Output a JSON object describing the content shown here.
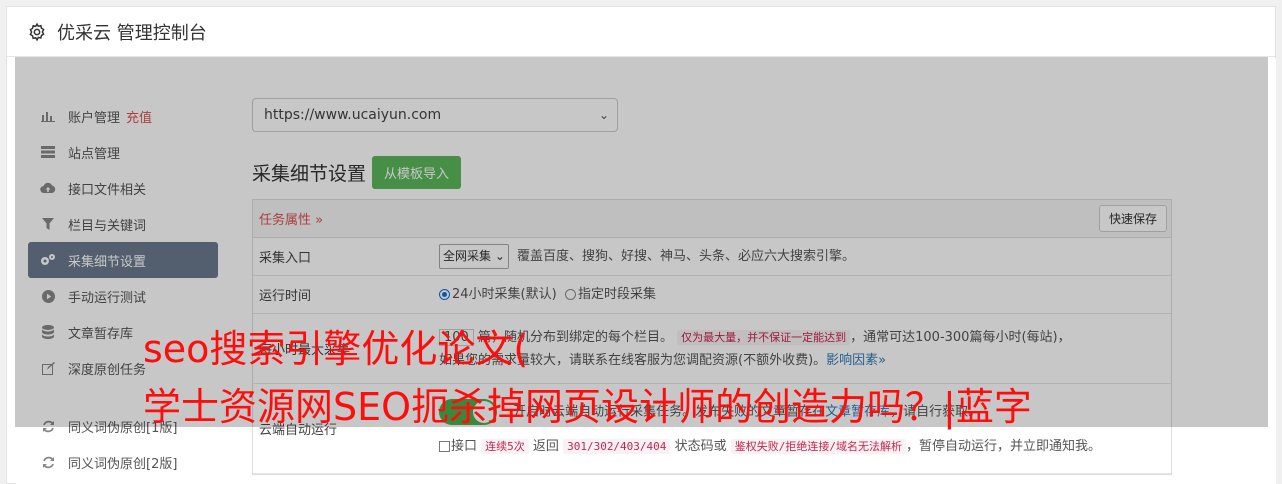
{
  "header": {
    "title": "优采云 管理控制台",
    "icon": "gear-icon"
  },
  "sidebar": {
    "items": [
      {
        "label": "账户管理",
        "badge": "充值",
        "icon": "bar-chart-icon"
      },
      {
        "label": "站点管理",
        "icon": "server-icon"
      },
      {
        "label": "接口文件相关",
        "icon": "cloud-upload-icon"
      },
      {
        "label": "栏目与关键词",
        "icon": "filter-icon"
      },
      {
        "label": "采集细节设置",
        "icon": "cogs-icon",
        "active": true
      },
      {
        "label": "手动运行测试",
        "icon": "play-circle-icon"
      },
      {
        "label": "文章暂存库",
        "icon": "database-icon"
      },
      {
        "label": "深度原创任务",
        "icon": "edit-icon"
      },
      {
        "label": "同义词伪原创[1版]",
        "icon": "refresh-icon"
      },
      {
        "label": "同义词伪原创[2版]",
        "icon": "refresh-icon"
      }
    ]
  },
  "main": {
    "site_select": "https://www.ucaiyun.com",
    "section_title": "采集细节设置",
    "import_button": "从模板导入",
    "panel": {
      "title": "任务属性",
      "save_button": "快速保存",
      "rows": {
        "entry_label": "采集入口",
        "entry_select": "全网采集",
        "entry_desc": "覆盖百度、搜狗、好搜、神马、头条、必应六大搜索引擎。",
        "time_label": "运行时间",
        "time_opt1": "24小时采集(默认)",
        "time_opt2": "指定时段采集",
        "max_label": "每小时最大采集",
        "max_text_a": "100",
        "max_text_b": "篇，随机分布到绑定的每个栏目。",
        "max_warn": "仅为最大量，并不保证一定能达到",
        "max_text_c": "，通常可达100-300篇每小时(每站)，",
        "max_text_d": "如果您的需求量较大，请联系在线客服为您调配资源(不额外收费)。",
        "max_link": "影响因素",
        "cloud_label": "云端自动运行",
        "cloud_desc_a": "开启时云端自动运行采集任务。发布失败的文章暂存在",
        "cloud_link": "文章暂存库",
        "cloud_desc_b": "，请自行获取。",
        "iface_a": "接口",
        "iface_code1": "连续5次",
        "iface_b": "返回",
        "iface_code2": "301/302/403/404",
        "iface_c": "状态码或",
        "iface_code3": "鉴权失败/拒绝连接/域名无法解析",
        "iface_d": "，暂停自动运行，并立即通知我。"
      }
    }
  },
  "overlay": {
    "line1": "seo搜索引擎优化论文(",
    "line2": "学士资源网SEO扼杀掉网页设计师的创造力吗？|蓝字"
  }
}
